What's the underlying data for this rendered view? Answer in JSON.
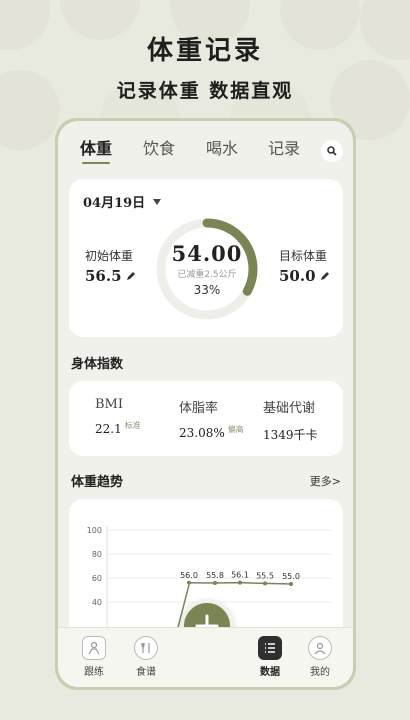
{
  "promo": {
    "title": "体重记录",
    "subtitle": "记录体重 数据直观"
  },
  "tabs": [
    {
      "label": "体重",
      "active": true
    },
    {
      "label": "饮食",
      "active": false
    },
    {
      "label": "喝水",
      "active": false
    },
    {
      "label": "记录",
      "active": false
    }
  ],
  "weight_card": {
    "date": "04月19日",
    "initial_label": "初始体重",
    "initial_value": "56.5",
    "current_weight": "54.00",
    "lost_text": "已减重2.5公斤",
    "progress_text": "33%",
    "progress": 0.33,
    "target_label": "目标体重",
    "target_value": "50.0"
  },
  "body_index": {
    "title": "身体指数",
    "items": [
      {
        "label": "BMI",
        "value": "22.1",
        "tag": "标准"
      },
      {
        "label": "体脂率",
        "value": "23.08%",
        "tag": "偏高"
      },
      {
        "label": "基础代谢",
        "value": "1349千卡",
        "tag": ""
      }
    ]
  },
  "trend": {
    "title": "体重趋势",
    "more_label": "更多>"
  },
  "chart_data": {
    "type": "line",
    "y_ticks": [
      "100",
      "80",
      "60",
      "40"
    ],
    "ylim": [
      40,
      100
    ],
    "values": [
      56.0,
      55.8,
      56.1,
      55.5,
      55.0
    ],
    "labels": [
      "56.0",
      "55.8",
      "56.1",
      "55.5",
      "55.0"
    ],
    "grid": true
  },
  "bottom_nav": [
    {
      "label": "跟练",
      "icon": "training-icon",
      "active": false
    },
    {
      "label": "食谱",
      "icon": "recipe-icon",
      "active": false
    },
    {
      "label": "数据",
      "icon": "data-list-icon",
      "active": true
    },
    {
      "label": "我的",
      "icon": "profile-icon",
      "active": false
    }
  ],
  "colors": {
    "accent": "#7a8556",
    "ring_track": "#eeeeea",
    "background": "#e9eadf"
  }
}
